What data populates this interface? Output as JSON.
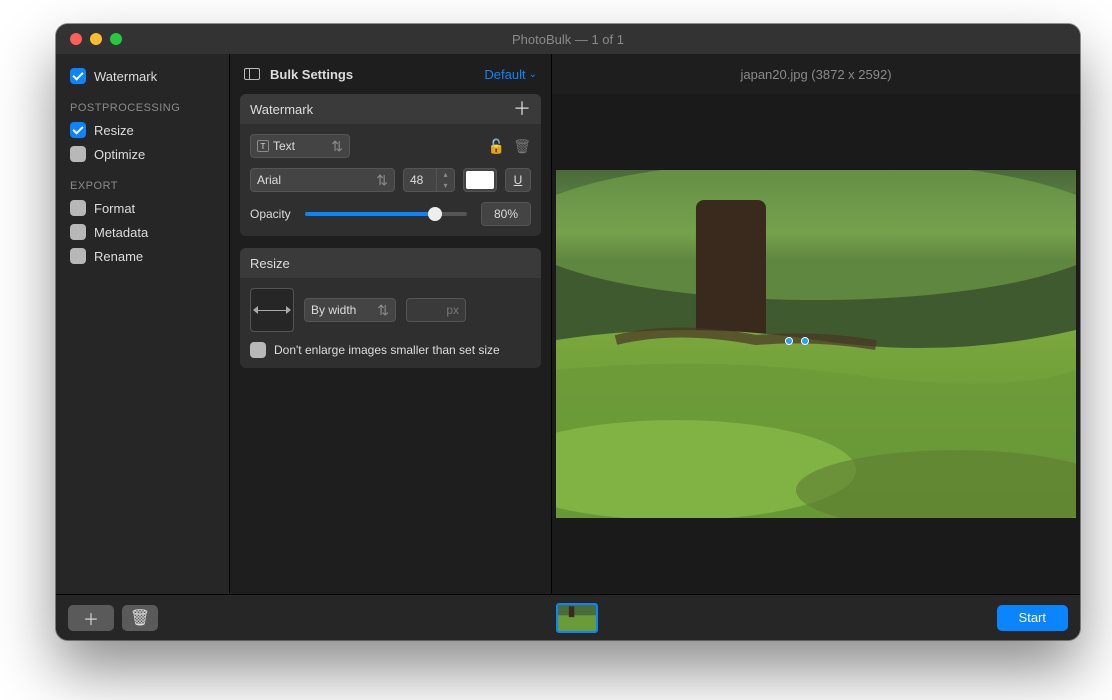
{
  "title": "PhotoBulk — 1 of 1",
  "sidebar": {
    "watermark": {
      "label": "Watermark",
      "on": true
    },
    "header_post": "POSTPROCESSING",
    "resize": {
      "label": "Resize",
      "on": true
    },
    "optimize": {
      "label": "Optimize",
      "on": false
    },
    "header_export": "EXPORT",
    "format": {
      "label": "Format",
      "on": false
    },
    "metadata": {
      "label": "Metadata",
      "on": false
    },
    "rename": {
      "label": "Rename",
      "on": false
    }
  },
  "settings": {
    "title": "Bulk Settings",
    "preset": "Default",
    "watermark": {
      "title": "Watermark",
      "type": "Text",
      "font": "Arial",
      "font_size": "48",
      "color": "#ffffff",
      "underline_label": "U",
      "opacity_label": "Opacity",
      "opacity_pct": 80,
      "opacity_display": "80%"
    },
    "resize": {
      "title": "Resize",
      "mode": "By width",
      "px_suffix": "px",
      "no_enlarge_label": "Don't enlarge images smaller than set size",
      "no_enlarge_on": false
    }
  },
  "preview": {
    "filename": "japan20.jpg",
    "dimensions": "(3872 x 2592)",
    "header": "japan20.jpg (3872 x 2592)"
  },
  "bottom": {
    "start": "Start"
  }
}
